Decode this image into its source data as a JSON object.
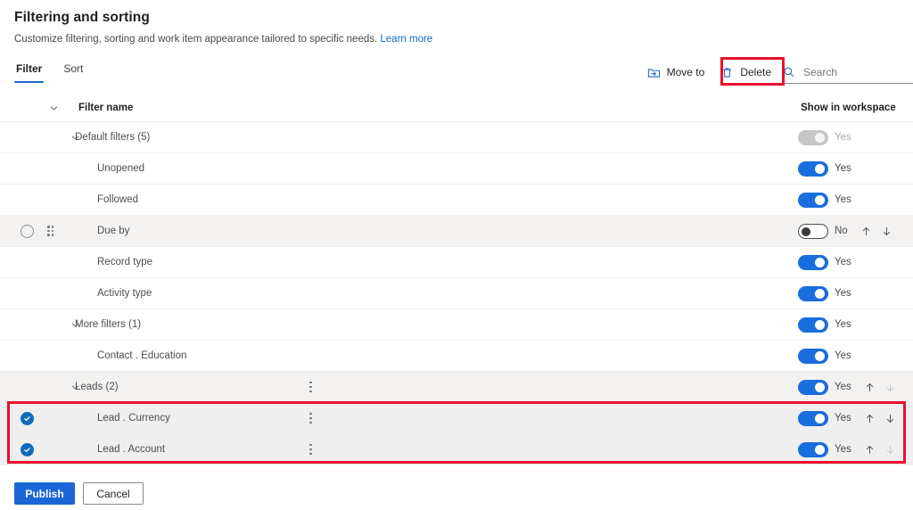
{
  "header": {
    "title": "Filtering and sorting",
    "subtitle": "Customize filtering, sorting and work item appearance tailored to specific needs.",
    "learn_more": "Learn more"
  },
  "tabs": [
    {
      "label": "Filter",
      "active": true
    },
    {
      "label": "Sort",
      "active": false
    }
  ],
  "toolbar": {
    "move_to_label": "Move to",
    "delete_label": "Delete",
    "search_placeholder": "Search",
    "search_value": ""
  },
  "grid": {
    "columns": {
      "filter_name": "Filter name",
      "show_in_workspace": "Show in workspace"
    },
    "rows": [
      {
        "name": "Default filters (5)",
        "type": "group",
        "expanded": true,
        "indent": 84,
        "toggle": "disabled",
        "toggle_label": "Yes",
        "selected": false,
        "hovered": false,
        "ellipsis": false,
        "arrows": "none"
      },
      {
        "name": "Unopened",
        "type": "item",
        "indent": 109,
        "toggle": "on",
        "toggle_label": "Yes",
        "selected": false,
        "hovered": false,
        "ellipsis": false,
        "arrows": "none"
      },
      {
        "name": "Followed",
        "type": "item",
        "indent": 109,
        "toggle": "on",
        "toggle_label": "Yes",
        "selected": false,
        "hovered": false,
        "ellipsis": false,
        "arrows": "none"
      },
      {
        "name": "Due by",
        "type": "item",
        "indent": 109,
        "toggle": "off",
        "toggle_label": "No",
        "selected": false,
        "hovered": true,
        "checkbox": "unchecked",
        "drag_handle": true,
        "ellipsis": false,
        "arrows": "both"
      },
      {
        "name": "Record type",
        "type": "item",
        "indent": 109,
        "toggle": "on",
        "toggle_label": "Yes",
        "selected": false,
        "hovered": false,
        "ellipsis": false,
        "arrows": "none"
      },
      {
        "name": "Activity type",
        "type": "item",
        "indent": 109,
        "toggle": "on",
        "toggle_label": "Yes",
        "selected": false,
        "hovered": false,
        "ellipsis": false,
        "arrows": "none"
      },
      {
        "name": "More filters (1)",
        "type": "group",
        "expanded": true,
        "indent": 84,
        "toggle": "on",
        "toggle_label": "Yes",
        "selected": false,
        "hovered": false,
        "ellipsis": false,
        "arrows": "none"
      },
      {
        "name": "Contact . Education",
        "type": "item",
        "indent": 109,
        "toggle": "on",
        "toggle_label": "Yes",
        "selected": false,
        "hovered": false,
        "ellipsis": false,
        "arrows": "none"
      },
      {
        "name": "Leads (2)",
        "type": "group",
        "expanded": true,
        "indent": 84,
        "toggle": "on",
        "toggle_label": "Yes",
        "selected": false,
        "hovered": true,
        "ellipsis": true,
        "arrows": "up-enabled-down-disabled"
      },
      {
        "name": "Lead . Currency",
        "type": "item",
        "indent": 109,
        "toggle": "on",
        "toggle_label": "Yes",
        "selected": true,
        "hovered": false,
        "checkbox": "checked",
        "ellipsis": true,
        "arrows": "both"
      },
      {
        "name": "Lead . Account",
        "type": "item",
        "indent": 109,
        "toggle": "on",
        "toggle_label": "Yes",
        "selected": true,
        "hovered": false,
        "checkbox": "checked",
        "ellipsis": true,
        "arrows": "up-enabled-down-disabled"
      }
    ]
  },
  "footer": {
    "publish_label": "Publish",
    "cancel_label": "Cancel"
  },
  "colors": {
    "accent": "#1a66d6",
    "link": "#0f6cbd",
    "toggle_on": "#1a6dde",
    "annotation": "#e8112d",
    "tab_underline": "#2266c8"
  },
  "annotations": [
    {
      "name": "delete-button-highlight",
      "target": "Delete"
    },
    {
      "name": "selected-rows-highlight",
      "target": "Lead . Currency / Lead . Account"
    }
  ]
}
